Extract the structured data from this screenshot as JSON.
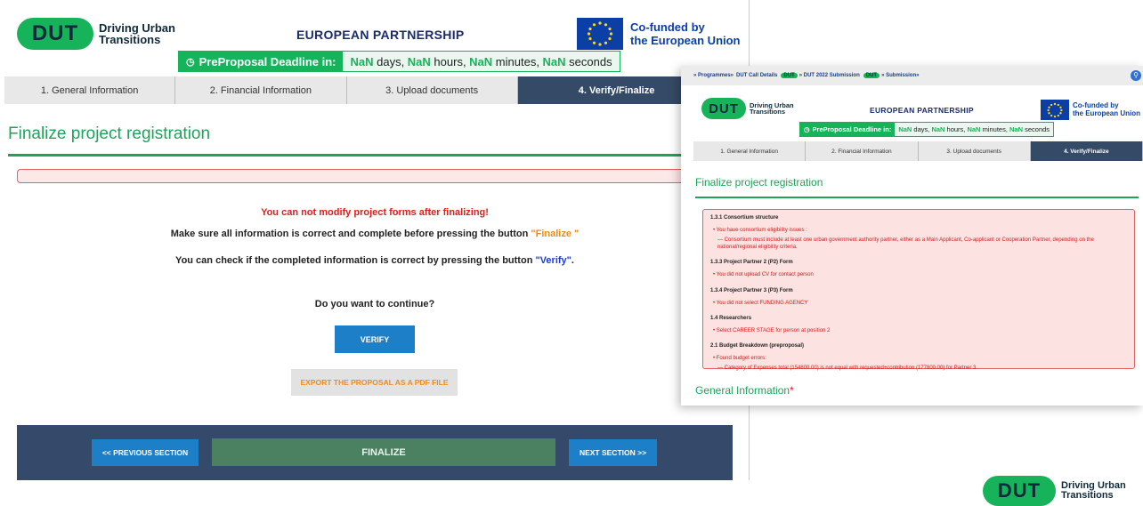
{
  "header": {
    "dut_logo_text": "DUT",
    "dut_tagline_line1": "Driving Urban",
    "dut_tagline_line2": "Transitions",
    "partnership": "EUROPEAN PARTNERSHIP",
    "cofunded_line1": "Co-funded by",
    "cofunded_line2": "the European Union",
    "eu_stars": "★ ★ ★ ★ ★ ★",
    "deadline_label": "PreProposal Deadline in:",
    "deadline_values": {
      "v1": "NaN",
      "u1": " days, ",
      "v2": "NaN",
      "u2": " hours, ",
      "v3": "NaN",
      "u3": " minutes, ",
      "v4": "NaN",
      "u4": " seconds"
    }
  },
  "tabs": [
    {
      "label": "1. General Information"
    },
    {
      "label": "2. Financial Information"
    },
    {
      "label": "3. Upload documents"
    },
    {
      "label": "4. Verify/Finalize"
    }
  ],
  "main": {
    "title": "Finalize project registration",
    "warning": "You can not modify project forms after finalizing!",
    "msg1_prefix": "Make sure all information is correct and complete before pressing the button ",
    "msg1_quote": "\"Finalize \"",
    "msg2_prefix": "You can check if the completed information is correct by pressing the button ",
    "msg2_quote": "\"Verify\"",
    "msg2_suffix": ".",
    "question": "Do you want to continue?",
    "verify_label": "VERIFY",
    "export_label": "EXPORT THE PROPOSAL AS A PDF FILE",
    "prev_label": "<< PREVIOUS SECTION",
    "finalize_label": "FINALIZE",
    "next_label": "NEXT SECTION >>"
  },
  "second": {
    "breadcrumb": {
      "c1": "» Programmes»",
      "c2": "DUT Call Details",
      "b1": "DUT",
      "c3": "» DUT 2022 Submission",
      "b2": "DUT",
      "c4": "» Submission»"
    },
    "title": "Finalize project registration",
    "errors": [
      {
        "heading": "1.3.1 Consortium structure",
        "items": [
          "• You have consortium eligibility issues :",
          "— Consortium must include at least one urban government authority partner, either as a Main Applicant, Co-applicant or Cooperation Partner, depending on the national/regional eligibility criteria."
        ]
      },
      {
        "heading": "1.3.3 Project Partner 2 (P2) Form",
        "items": [
          "• You did not upload CV for contact person"
        ]
      },
      {
        "heading": "1.3.4 Project Partner 3 (P3) Form",
        "items": [
          "• You did not select FUNDING AGENCY"
        ]
      },
      {
        "heading": "1.4 Researchers",
        "items": [
          "• Select CAREER STAGE for person at position 2"
        ]
      },
      {
        "heading": "2.1 Budget Breakdown (preproposal)",
        "items": [
          "• Found budget errors:",
          "— Category of Expenses total (154800.00) is not equal with requested+contribution (177800.00) for Partner 3."
        ]
      }
    ],
    "general_info_title": "General Information",
    "required_star": "*"
  },
  "corner_logo": {
    "text": "DUT",
    "line1": "Driving Urban",
    "line2": "Transitions"
  },
  "colors": {
    "brand_green": "#17b35a",
    "nav_blue": "#35496a",
    "button_blue": "#1e7fc9",
    "eu_blue": "#0b3fa6",
    "error_red": "#e31b1b"
  }
}
